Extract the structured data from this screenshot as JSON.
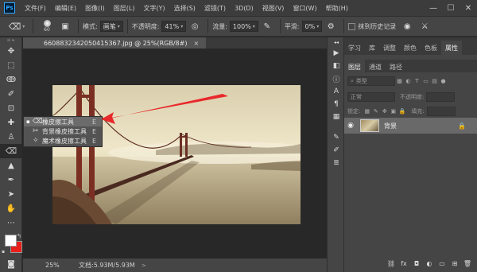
{
  "app": {
    "logo": "Ps",
    "menu": [
      "文件(F)",
      "编辑(E)",
      "图像(I)",
      "图层(L)",
      "文字(Y)",
      "选择(S)",
      "滤镜(T)",
      "3D(D)",
      "视图(V)",
      "窗口(W)",
      "帮助(H)"
    ],
    "window_controls": [
      "—",
      "☐",
      "✕"
    ]
  },
  "options_bar": {
    "brush_size": "60",
    "mode_label": "模式:",
    "mode_value": "画笔",
    "opacity_label": "不透明度:",
    "opacity_value": "41%",
    "flow_label": "流量:",
    "flow_value": "100%",
    "smoothing_label": "平滑:",
    "smoothing_value": "0%",
    "erase_history_label": "抹到历史记录"
  },
  "document": {
    "tab_title": "6608832342050415367.jpg @ 25%(RGB/8#)",
    "tab_close": "×",
    "zoom": "25%",
    "doc_info": "文档:5.93M/5.93M",
    "status_arrow": ">"
  },
  "eraser_flyout": {
    "items": [
      {
        "label": "橡皮擦工具",
        "key": "E",
        "selected": true
      },
      {
        "label": "背景橡皮擦工具",
        "key": "E",
        "selected": false
      },
      {
        "label": "魔术橡皮擦工具",
        "key": "E",
        "selected": false
      }
    ]
  },
  "colors": {
    "foreground": "#ffffff",
    "background": "#e8201b",
    "annotation_arrow": "#e8292b"
  },
  "right_panel": {
    "top_tabs": [
      "学习",
      "库",
      "调整",
      "颜色",
      "色板",
      "属性"
    ],
    "active_top_tab": "属性",
    "layer_tabs": [
      "图层",
      "通道",
      "路径"
    ],
    "active_layer_tab": "图层",
    "filter_placeholder": "类型",
    "blend_mode": "正常",
    "opacity_label": "不透明度:",
    "lock_label": "锁定:",
    "fill_label": "填充:",
    "layers": [
      {
        "name": "背景",
        "visible": true,
        "locked": true
      }
    ]
  }
}
